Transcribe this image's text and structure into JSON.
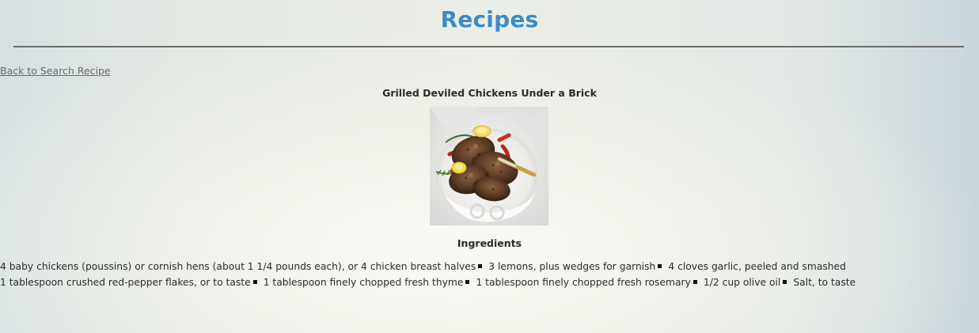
{
  "page": {
    "title": "Recipes",
    "back_link": "Back to Search Recipe"
  },
  "recipe": {
    "name": "Grilled Deviled Chickens Under a Brick",
    "image_alt": "Grilled Deviled Chickens Under a Brick",
    "ingredients_heading": "Ingredients",
    "ingredients": [
      "4 baby chickens (poussins) or cornish hens (about 1 1/4 pounds each), or 4 chicken breast halves",
      "3 lemons, plus wedges for garnish",
      "4 cloves garlic, peeled and smashed",
      "1 tablespoon crushed red-pepper flakes, or to taste",
      "1 tablespoon finely chopped fresh thyme",
      "1 tablespoon finely chopped fresh rosemary",
      "1/2 cup olive oil",
      "Salt, to taste"
    ]
  },
  "colors": {
    "title": "#3a8cc8",
    "rule": "#6b6b68",
    "link": "#6a6a6a"
  }
}
